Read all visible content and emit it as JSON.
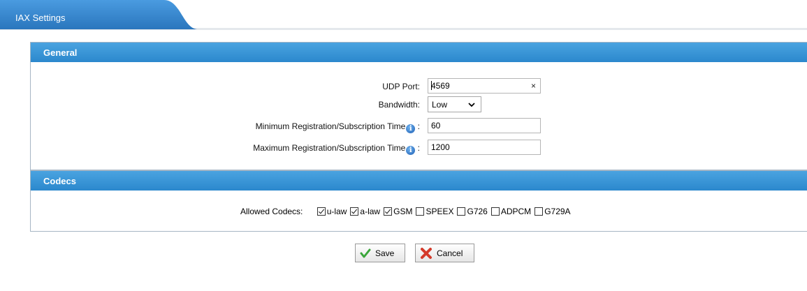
{
  "tab": {
    "label": "IAX Settings"
  },
  "general": {
    "title": "General",
    "udp_port": {
      "label": "UDP Port:",
      "value": "4569",
      "clear": "×"
    },
    "bandwidth": {
      "label": "Bandwidth:",
      "value": "Low"
    },
    "min_time": {
      "label": "Minimum Registration/Subscription Time",
      "value": "60"
    },
    "max_time": {
      "label": "Maximum Registration/Subscription Time",
      "value": "1200"
    },
    "info_glyph": "i",
    "colon": ":"
  },
  "codecs": {
    "title": "Codecs",
    "label": "Allowed Codecs:",
    "items": [
      {
        "name": "u-law",
        "checked": true
      },
      {
        "name": "a-law",
        "checked": true
      },
      {
        "name": "GSM",
        "checked": true
      },
      {
        "name": "SPEEX",
        "checked": false
      },
      {
        "name": "G726",
        "checked": false
      },
      {
        "name": "ADPCM",
        "checked": false
      },
      {
        "name": "G729A",
        "checked": false
      }
    ]
  },
  "buttons": {
    "save": "Save",
    "cancel": "Cancel"
  },
  "colors": {
    "accent": "#2b88cd",
    "tab": "#2f7fc4"
  }
}
